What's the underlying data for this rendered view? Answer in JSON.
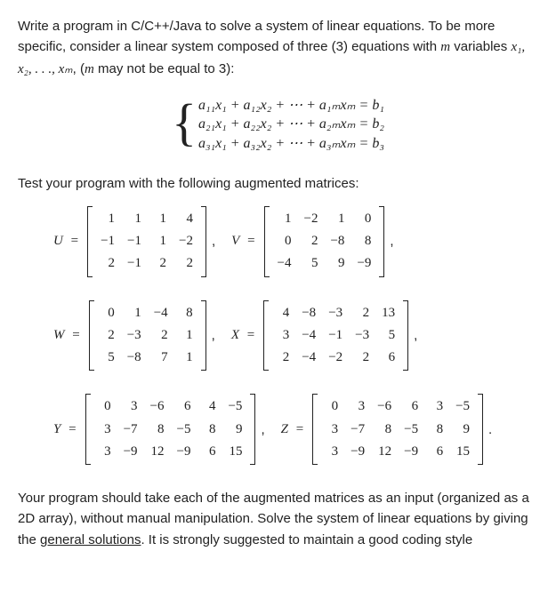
{
  "intro": {
    "p1_a": "Write a program in C/C++/Java to solve a system of linear equations. To be more specific, consider a linear system composed of three (3) equations with ",
    "p1_m": "m",
    "p1_b": " variables ",
    "p1_vars": "x₁, x₂, . . ., xₘ",
    "p1_c": ", (",
    "p1_m2": "m",
    "p1_d": " may not be equal to 3):"
  },
  "system": {
    "line1": "a₁₁x₁ + a₁₂x₂ + ⋯ + a₁ₘxₘ = b₁",
    "line2": "a₂₁x₁ + a₂₂x₂ + ⋯ + a₂ₘxₘ = b₂",
    "line3": "a₃₁x₁ + a₃₂x₂ + ⋯ + a₃ₘxₘ = b₃"
  },
  "test_header": "Test your program with the following augmented matrices:",
  "matrices": {
    "U": {
      "label": "U",
      "rows": [
        [
          " 1",
          " 1",
          "1",
          " 4"
        ],
        [
          "−1",
          "−1",
          "1",
          "−2"
        ],
        [
          " 2",
          "−1",
          "2",
          " 2"
        ]
      ]
    },
    "V": {
      "label": "V",
      "rows": [
        [
          " 1",
          "−2",
          " 1",
          " 0"
        ],
        [
          " 0",
          " 2",
          "−8",
          " 8"
        ],
        [
          "−4",
          " 5",
          " 9",
          "−9"
        ]
      ]
    },
    "W": {
      "label": "W",
      "rows": [
        [
          "0",
          " 1",
          "−4",
          "8"
        ],
        [
          "2",
          "−3",
          " 2",
          "1"
        ],
        [
          "5",
          "−8",
          " 7",
          "1"
        ]
      ]
    },
    "X": {
      "label": "X",
      "rows": [
        [
          "4",
          "−8",
          "−3",
          " 2",
          "13"
        ],
        [
          "3",
          "−4",
          "−1",
          "−3",
          " 5"
        ],
        [
          "2",
          "−4",
          "−2",
          " 2",
          " 6"
        ]
      ]
    },
    "Y": {
      "label": "Y",
      "rows": [
        [
          "0",
          " 3",
          "−6",
          " 6",
          "4",
          "−5"
        ],
        [
          "3",
          "−7",
          " 8",
          "−5",
          "8",
          " 9"
        ],
        [
          "3",
          "−9",
          "12",
          "−9",
          "6",
          "15"
        ]
      ]
    },
    "Z": {
      "label": "Z",
      "rows": [
        [
          "0",
          " 3",
          "−6",
          " 6",
          "3",
          "−5"
        ],
        [
          "3",
          "−7",
          " 8",
          "−5",
          "8",
          " 9"
        ],
        [
          "3",
          "−9",
          "12",
          "−9",
          "6",
          "15"
        ]
      ]
    }
  },
  "outro": {
    "a": "Your program should take each of the augmented matrices as an input (organized as a 2D array), without manual manipulation. Solve the system of linear equations by giving the ",
    "u": "general solutions",
    "b": ". It is strongly suggested to maintain a good coding style"
  }
}
